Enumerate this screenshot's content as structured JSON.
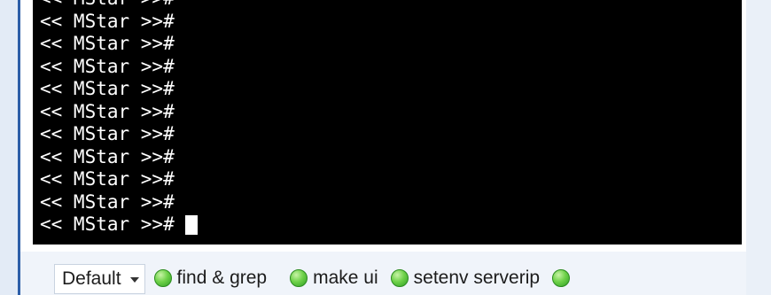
{
  "terminal": {
    "lines": [
      "<< MStar >>#",
      "<< MStar >>#",
      "<< MStar >>#",
      "<< MStar >>#",
      "<< MStar >>#",
      "<< MStar >>#",
      "<< MStar >>#",
      "<< MStar >>#",
      "<< MStar >>#",
      "<< MStar >>#",
      "<< MStar >>#"
    ]
  },
  "toolbar": {
    "profile": "Default",
    "buttons": [
      {
        "label": "find & grep",
        "icon": "green-orb-icon"
      },
      {
        "label": "make ui",
        "icon": "green-orb-icon"
      },
      {
        "label": "setenv serverip",
        "icon": "green-orb-icon"
      },
      {
        "label": "",
        "icon": "green-orb-icon"
      }
    ]
  },
  "colors": {
    "terminal_bg": "#000000",
    "terminal_fg": "#ffffff",
    "accent": "#2d5ea8"
  }
}
